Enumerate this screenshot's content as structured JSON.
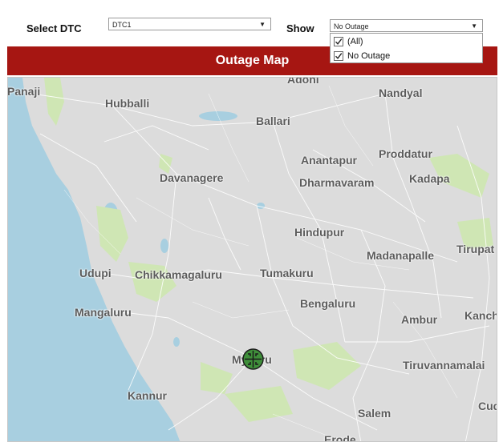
{
  "filters": {
    "dtc_label": "Select DTC",
    "dtc_value": "DTC1",
    "show_label": "Show",
    "show_value": "No Outage",
    "show_options": [
      {
        "label": "(All)",
        "checked": true
      },
      {
        "label": "No Outage",
        "checked": true
      }
    ]
  },
  "map": {
    "title": "Outage Map",
    "marker_icon": "outage-marker-icon",
    "cities": [
      "Adoni",
      "Panaji",
      "Hubballi",
      "Nandyal",
      "Ballari",
      "Proddatur",
      "Anantapur",
      "Kadapa",
      "Davanagere",
      "Dharmavaram",
      "Hindupur",
      "Tirupat",
      "Madanapalle",
      "Udupi",
      "Chikkamagaluru",
      "Tumakuru",
      "Bengaluru",
      "Mangaluru",
      "Ambur",
      "Kanch",
      "Mysuru",
      "Tiruvannamalai",
      "Kannur",
      "Cud",
      "Salem",
      "Erode"
    ]
  },
  "colors": {
    "title_bar": "#a61612",
    "sea": "#a8cfe0",
    "land": "#dcdcdc",
    "forest": "#cfe6b4",
    "marker": "#3f8f3a"
  }
}
